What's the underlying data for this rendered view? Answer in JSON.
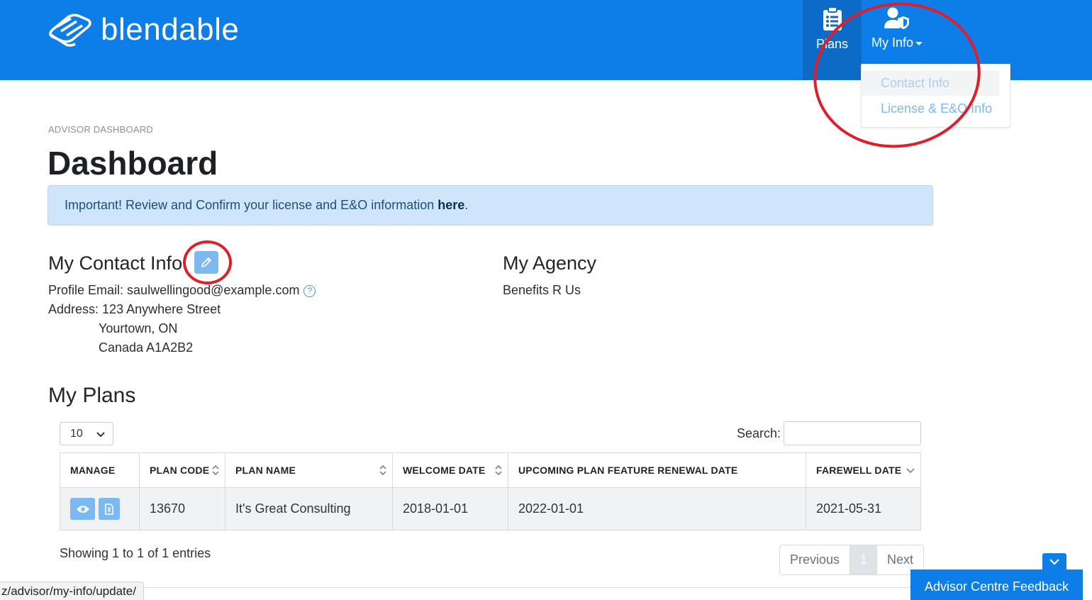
{
  "header": {
    "brand": "blendable",
    "nav": {
      "plans_label": "Plans",
      "myinfo_label": "My Info"
    },
    "dropdown": {
      "items": [
        "Contact Info",
        "License & E&O Info"
      ]
    }
  },
  "breadcrumb": "ADVISOR DASHBOARD",
  "page_title": "Dashboard",
  "alert": {
    "text": "Important! Review and Confirm your license and E&O information ",
    "link": "here",
    "suffix": "."
  },
  "contact": {
    "heading": "My Contact Info",
    "email_label": "Profile Email: ",
    "email": "saulwellingood@example.com",
    "address_label": "Address: ",
    "address_lines": [
      "123 Anywhere Street",
      "Yourtown, ON",
      "Canada A1A2B2"
    ]
  },
  "agency": {
    "heading": "My Agency",
    "name": "Benefits R Us"
  },
  "plans": {
    "heading": "My Plans",
    "page_length": "10",
    "search_label": "Search:",
    "columns": [
      "MANAGE",
      "PLAN CODE",
      "PLAN NAME",
      "WELCOME DATE",
      "UPCOMING PLAN FEATURE RENEWAL DATE",
      "FAREWELL DATE"
    ],
    "rows": [
      {
        "plan_code": "13670",
        "plan_name": "It's Great Consulting",
        "welcome_date": "2018-01-01",
        "renewal_date": "2022-01-01",
        "farewell_date": "2021-05-31"
      }
    ],
    "showing": "Showing 1 to 1 of 1 entries",
    "pager": {
      "previous": "Previous",
      "current": "1",
      "next": "Next"
    }
  },
  "status_url": "z/advisor/my-info/update/",
  "feedback_label": "Advisor Centre Feedback",
  "colors": {
    "brand_blue": "#0d7ee8",
    "button_blue": "#7cb8f2",
    "annotation_red": "#e11d2a"
  }
}
